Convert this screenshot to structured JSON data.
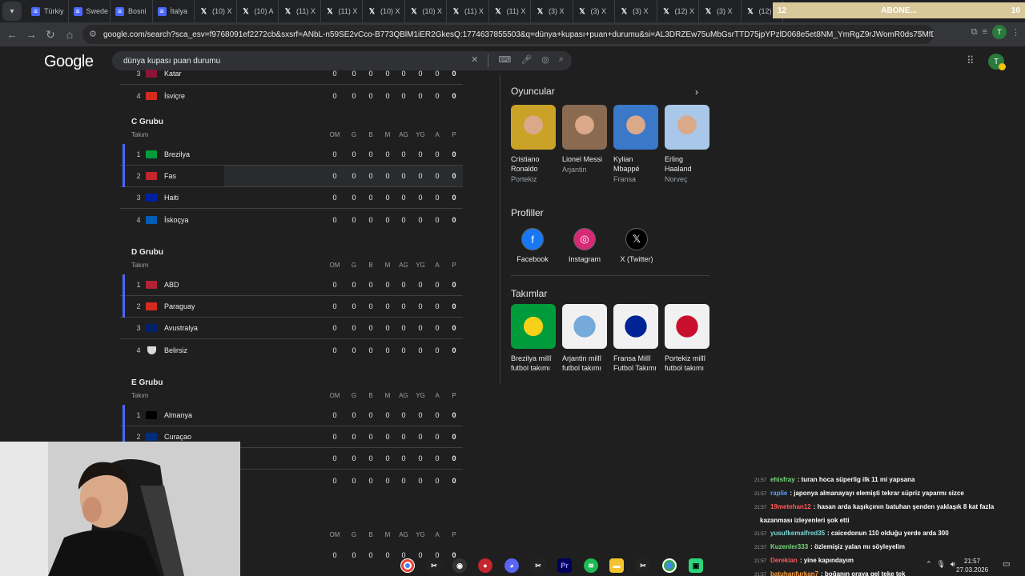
{
  "browser": {
    "tab_menu_icon": "chevron-down",
    "tabs": [
      {
        "label": "Türkiy",
        "icon": "doc"
      },
      {
        "label": "Swede",
        "icon": "doc"
      },
      {
        "label": "Bosni",
        "icon": "doc"
      },
      {
        "label": "İtalya",
        "icon": "doc"
      },
      {
        "label": "(10) X",
        "icon": "x"
      },
      {
        "label": "(10) A",
        "icon": "x"
      },
      {
        "label": "(11) X",
        "icon": "x"
      },
      {
        "label": "(11) X",
        "icon": "x"
      },
      {
        "label": "(10) X",
        "icon": "x"
      },
      {
        "label": "(10) X",
        "icon": "x"
      },
      {
        "label": "(11) X",
        "icon": "x"
      },
      {
        "label": "(11) X",
        "icon": "x"
      },
      {
        "label": "(3) X",
        "icon": "x"
      },
      {
        "label": "(3) X",
        "icon": "x"
      },
      {
        "label": "(3) X",
        "icon": "x"
      },
      {
        "label": "(12) X",
        "icon": "x"
      },
      {
        "label": "(3) X",
        "icon": "x"
      },
      {
        "label": "(12) X",
        "icon": "x"
      }
    ],
    "banner": {
      "left": "12",
      "center": "ABONE...",
      "right": "10"
    },
    "url": "google.com/search?sca_esv=f9768091ef2272cb&sxsrf=ANbL-n59SE2vCco-B773QBlM1iER2GkesQ:1774637855503&q=dünya+kupası+puan+durumu&si=AL3DRZEw75uMbGsrTTD75jpYPzlD068e5et8NM_YmRgZ9rJWomR0ds75MfDf-wbWJm6d...",
    "profile_initial": "T"
  },
  "google": {
    "logo": "Google",
    "query": "dünya kupası puan durumu",
    "avatar_initial": "T"
  },
  "headers": {
    "team": "Takım",
    "cols": [
      "OM",
      "G",
      "B",
      "M",
      "AG",
      "YG",
      "A",
      "P"
    ]
  },
  "group_b_tail": [
    {
      "rank": "3",
      "team": "Katar",
      "stats": [
        "0",
        "0",
        "0",
        "0",
        "0",
        "0",
        "0",
        "0"
      ]
    },
    {
      "rank": "4",
      "team": "İsviçre",
      "stats": [
        "0",
        "0",
        "0",
        "0",
        "0",
        "0",
        "0",
        "0"
      ]
    }
  ],
  "groups": [
    {
      "title": "C Grubu",
      "rows": [
        {
          "rank": "1",
          "team": "Brezilya",
          "stats": [
            "0",
            "0",
            "0",
            "0",
            "0",
            "0",
            "0",
            "0"
          ]
        },
        {
          "rank": "2",
          "team": "Fas",
          "stats": [
            "0",
            "0",
            "0",
            "0",
            "0",
            "0",
            "0",
            "0"
          ]
        },
        {
          "rank": "3",
          "team": "Haiti",
          "stats": [
            "0",
            "0",
            "0",
            "0",
            "0",
            "0",
            "0",
            "0"
          ]
        },
        {
          "rank": "4",
          "team": "İskoçya",
          "stats": [
            "0",
            "0",
            "0",
            "0",
            "0",
            "0",
            "0",
            "0"
          ]
        }
      ]
    },
    {
      "title": "D Grubu",
      "rows": [
        {
          "rank": "1",
          "team": "ABD",
          "stats": [
            "0",
            "0",
            "0",
            "0",
            "0",
            "0",
            "0",
            "0"
          ]
        },
        {
          "rank": "2",
          "team": "Paraguay",
          "stats": [
            "0",
            "0",
            "0",
            "0",
            "0",
            "0",
            "0",
            "0"
          ]
        },
        {
          "rank": "3",
          "team": "Avustralya",
          "stats": [
            "0",
            "0",
            "0",
            "0",
            "0",
            "0",
            "0",
            "0"
          ]
        },
        {
          "rank": "4",
          "team": "Belirsiz",
          "stats": [
            "0",
            "0",
            "0",
            "0",
            "0",
            "0",
            "0",
            "0"
          ]
        }
      ]
    },
    {
      "title": "E Grubu",
      "rows": [
        {
          "rank": "1",
          "team": "Almanya",
          "stats": [
            "0",
            "0",
            "0",
            "0",
            "0",
            "0",
            "0",
            "0"
          ]
        },
        {
          "rank": "2",
          "team": "Curaçao",
          "stats": [
            "0",
            "0",
            "0",
            "0",
            "0",
            "0",
            "0",
            "0"
          ]
        },
        {
          "rank": "",
          "team": "",
          "stats": [
            "0",
            "0",
            "0",
            "0",
            "0",
            "0",
            "0",
            "0"
          ]
        },
        {
          "rank": "",
          "team": "",
          "stats": [
            "0",
            "0",
            "0",
            "0",
            "0",
            "0",
            "0",
            "0"
          ]
        }
      ]
    }
  ],
  "next_group_rows": [
    {
      "stats": [
        "0",
        "0",
        "0",
        "0",
        "0",
        "0",
        "0",
        "0"
      ]
    }
  ],
  "panel": {
    "players_title": "Oyuncular",
    "players": [
      {
        "name": "Cristiano Ronaldo",
        "country": "Portekiz"
      },
      {
        "name": "Lionel Messi",
        "country": "Arjantin"
      },
      {
        "name": "Kylian Mbappé",
        "country": "Fransa"
      },
      {
        "name": "Erling Haaland",
        "country": "Norveç"
      }
    ],
    "profiles_title": "Profiller",
    "profiles": [
      {
        "label": "Facebook",
        "icon": "facebook-icon"
      },
      {
        "label": "Instagram",
        "icon": "instagram-icon"
      },
      {
        "label": "X (Twitter)",
        "icon": "x-icon"
      }
    ],
    "teams_title": "Takımlar",
    "teams": [
      {
        "name": "Brezilya millî futbol takımı"
      },
      {
        "name": "Arjantin millî futbol takımı"
      },
      {
        "name": "Fransa Millî Futbol Takımı"
      },
      {
        "name": "Portekiz millî futbol takımı"
      }
    ]
  },
  "chat": [
    {
      "time": "21:57",
      "user": "ehisfray",
      "color": "#7bd97b",
      "msg": ": turan hoca süperlig ilk 11 mi yapsana"
    },
    {
      "time": "21:57",
      "user": "raplie",
      "color": "#5aa0ff",
      "msg": ": japonya almanayayı elemişti tekrar süpriz yaparmı sizce"
    },
    {
      "time": "21:57",
      "user": "19metehan12",
      "color": "#ff5a5a",
      "msg": ": hasan arda kaşıkçının batuhan şenden yaklaşık 8 kat fazla"
    },
    {
      "time": "",
      "user": "",
      "color": "#ffffff",
      "msg": "kazanması izleyenleri şok etti"
    },
    {
      "time": "21:57",
      "user": "yusufkemalfred35",
      "color": "#7bd9d9",
      "msg": ": caicedonun 110 olduğu yerde arda 300"
    },
    {
      "time": "21:57",
      "user": "Kuzenler333",
      "color": "#7bd97b",
      "msg": ": özlemişiz yalan mı söyleyelim"
    },
    {
      "time": "21:57",
      "user": "Derekian",
      "color": "#ff5a5a",
      "msg": ": yine kapındayım"
    },
    {
      "time": "21:57",
      "user": "batuhanfurkan7",
      "color": "#ff9f3a",
      "msg": ": boğanın oraya gel teke tek"
    }
  ],
  "clock": {
    "time": "21:57",
    "date": "27.03.2026"
  }
}
